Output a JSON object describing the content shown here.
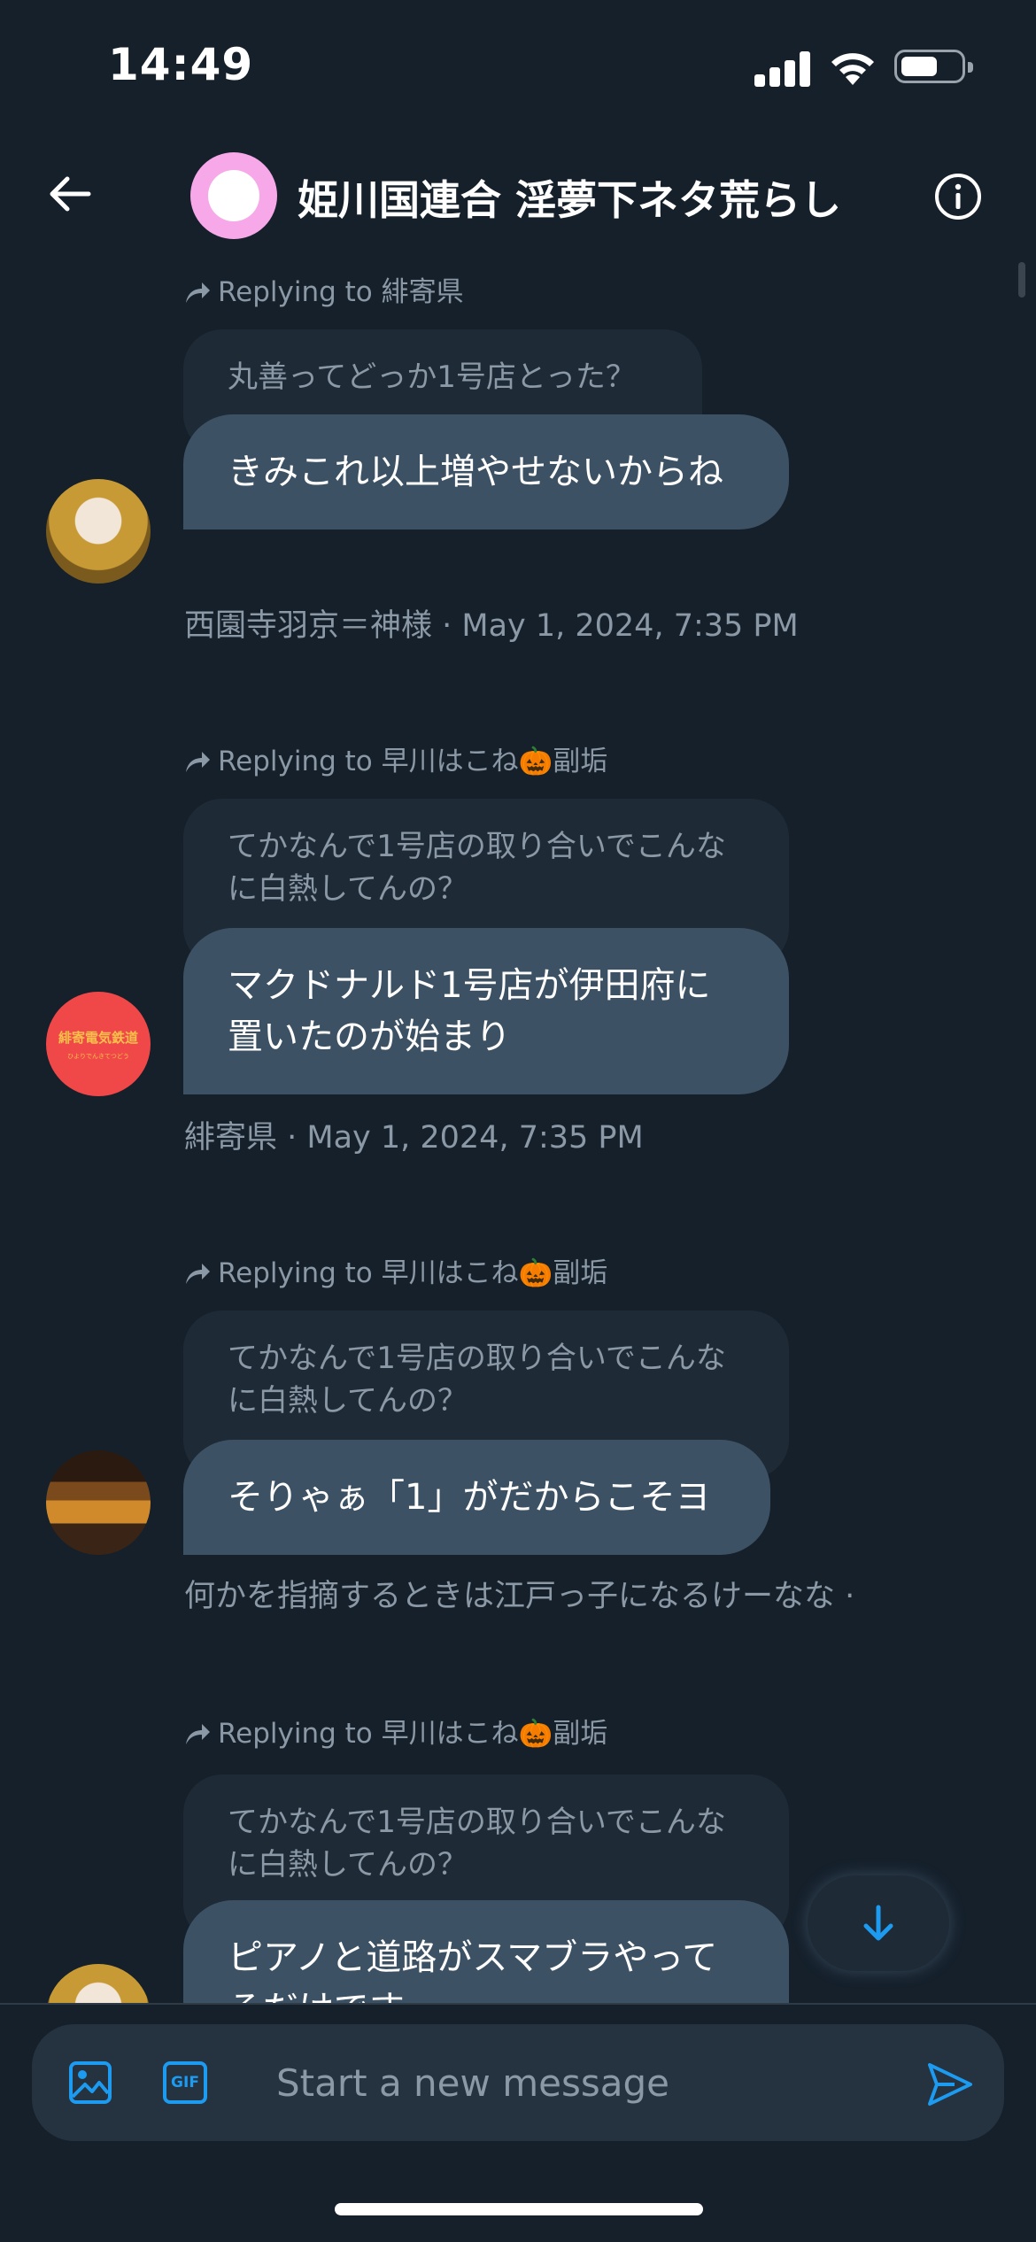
{
  "status_bar": {
    "time": "14:49"
  },
  "header": {
    "title": "姫川国連合 淫夢下ネタ荒らし"
  },
  "messages": [
    {
      "reply_prefix": "Replying to",
      "reply_to": "緋寄県",
      "quoted_text": "丸善ってどっか1号店とった？",
      "text": "きみこれ以上増やせないからね",
      "meta": "西園寺羽京＝神様 · May 1, 2024, 7:35 PM",
      "avatar": "avatar-yellow-character"
    },
    {
      "reply_prefix": "Replying to",
      "reply_to": "早川はこね🎃副垢",
      "quoted_text": "てかなんで1号店の取り合いでこんなに白熱してんの？",
      "text": "マクドナルド1号店が伊田府に置いたのが始まり",
      "meta": "緋寄県 · May 1, 2024, 7:35 PM",
      "avatar": "avatar-red-logo",
      "avatar_logo_line1": "緋寄電気鉄道",
      "avatar_logo_line2": "ひよりでんきてつどう"
    },
    {
      "reply_prefix": "Replying to",
      "reply_to": "早川はこね🎃副垢",
      "quoted_text": "てかなんで1号店の取り合いでこんなに白熱してんの？",
      "text": "そりゃぁ「1」がだからこそヨ",
      "meta": "何かを指摘するときは江戸っ子になるけーなな ·",
      "avatar": "avatar-train"
    },
    {
      "reply_prefix": "Replying to",
      "reply_to": "早川はこね🎃副垢",
      "quoted_text": "てかなんで1号店の取り合いでこんなに白熱してんの？",
      "text": "ピアノと道路がスマブラやってるだけです",
      "avatar": "avatar-yellow-character"
    }
  ],
  "composer": {
    "placeholder": "Start a new message",
    "gif_label": "GIF"
  },
  "colors": {
    "background": "#15202b",
    "bubble": "#3c5163",
    "quote": "#1e2a36",
    "accent": "#1d9bf0",
    "muted_text": "#8b98a5"
  }
}
